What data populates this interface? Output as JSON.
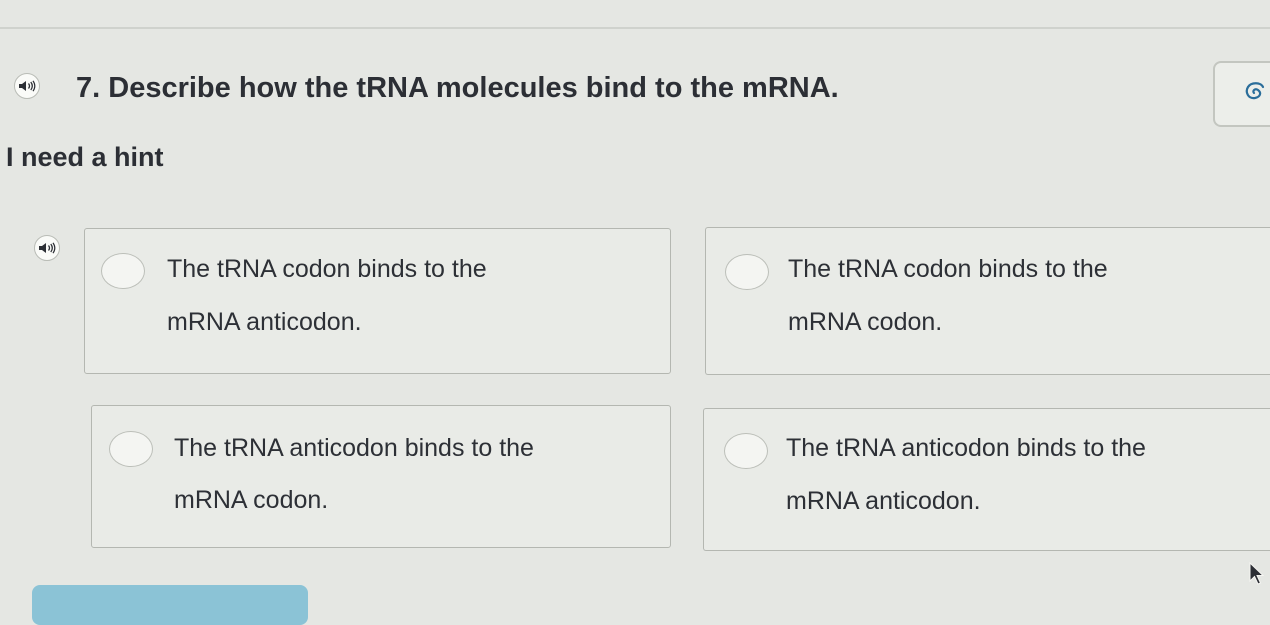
{
  "question": {
    "number": "7.",
    "text": "Describe how the tRNA molecules bind to the mRNA.",
    "audio_icon": "speaker-icon"
  },
  "tool_icon": "bubble-icon",
  "hint": {
    "label": "I need a hint"
  },
  "choices": [
    {
      "line1": "The tRNA codon binds to the",
      "line2": "mRNA anticodon."
    },
    {
      "line1": "The tRNA codon binds to the",
      "line2": "mRNA codon."
    },
    {
      "line1": "The tRNA anticodon binds to the",
      "line2": "mRNA codon."
    },
    {
      "line1": "The tRNA anticodon binds to the",
      "line2": "mRNA anticodon."
    }
  ],
  "colors": {
    "page_background": "#e5e7e3",
    "question_text": "#2c2f35",
    "check_button": "#8bc3d6"
  }
}
